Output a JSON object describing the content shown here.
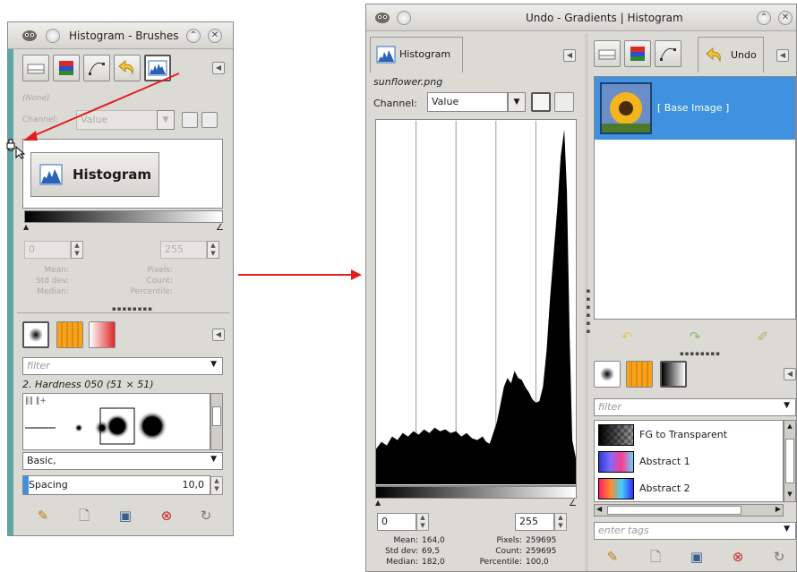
{
  "left_window": {
    "title": "Histogram - Brushes",
    "image_label": "(None)",
    "channel_label": "Channel:",
    "channel_value": "Value",
    "drag_label": "Histogram",
    "range_min": "0",
    "range_max": "255",
    "stats_left": [
      "Mean:",
      "Std dev:",
      "Median:"
    ],
    "stats_right": [
      "Pixels:",
      "Count:",
      "Percentile:"
    ],
    "filter_placeholder": "filter",
    "brush_name": "2. Hardness 050 (51 × 51)",
    "brush_tag": "Basic,",
    "spacing_label": "Spacing",
    "spacing_value": "10,0"
  },
  "right_window": {
    "title": "Undo - Gradients | Histogram",
    "tab_histogram": "Histogram",
    "tab_undo": "Undo",
    "image_name": "sunflower.png",
    "channel_label": "Channel:",
    "channel_value": "Value",
    "range_min": "0",
    "range_max": "255",
    "stats": [
      {
        "label": "Mean:",
        "value": "164,0"
      },
      {
        "label": "Std dev:",
        "value": "69,5"
      },
      {
        "label": "Median:",
        "value": "182,0"
      }
    ],
    "stats_right": [
      {
        "label": "Pixels:",
        "value": "259695"
      },
      {
        "label": "Count:",
        "value": "259695"
      },
      {
        "label": "Percentile:",
        "value": "100,0"
      }
    ],
    "undo_item": "[ Base Image ]",
    "filter_placeholder": "filter",
    "gradients": [
      "FG to Transparent",
      "Abstract 1",
      "Abstract 2"
    ],
    "tags_placeholder": "enter tags"
  },
  "colors": {
    "selection": "#3e92df",
    "arrow": "#e02020",
    "window_bg": "#dcdad5"
  }
}
